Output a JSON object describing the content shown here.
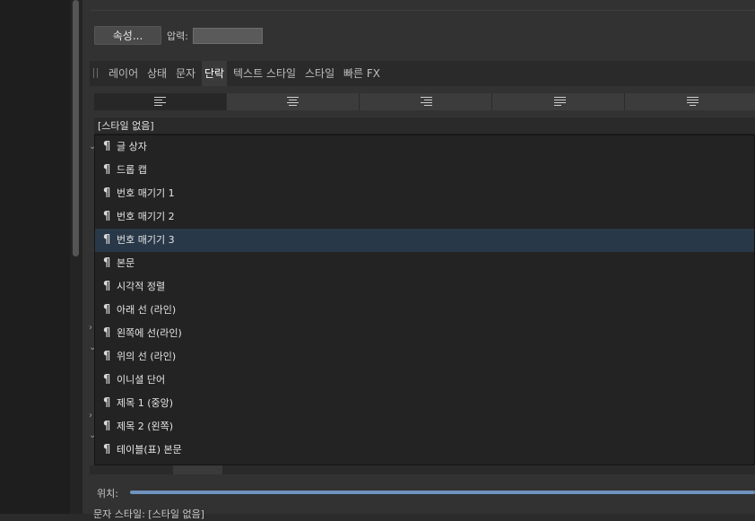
{
  "toolbar": {
    "properties_button": "속성...",
    "pressure_label": "압력:"
  },
  "tabs": [
    {
      "label": "레이어"
    },
    {
      "label": "상태"
    },
    {
      "label": "문자"
    },
    {
      "label": "단락",
      "active": true
    },
    {
      "label": "텍스트 스타일"
    },
    {
      "label": "스타일"
    },
    {
      "label": "빠른 FX"
    }
  ],
  "alignment": {
    "options": [
      "align-left-icon",
      "align-center-icon",
      "align-right-icon",
      "justify-left-icon",
      "justify-center-icon"
    ],
    "selected_index": 0
  },
  "paragraph_style": {
    "selected": "[스타일 없음]",
    "options": [
      "글 상자",
      "드롭 캡",
      "번호 매기기 1",
      "번호 매기기 2",
      "번호 매기기 3",
      "본문",
      "시각적 정렬",
      "아래 선 (라인)",
      "왼쪽에 선(라인)",
      "위의 선 (라인)",
      "이니셜 단어",
      "제목 1 (중앙)",
      "제목 2 (왼쪽)",
      "테이블(표) 본문"
    ],
    "hovered_index": 4,
    "option_glyph": "¶"
  },
  "position": {
    "label": "위치:"
  },
  "character_style": {
    "text": "문자 스타일: [스타일 없음]"
  },
  "colors": {
    "hover_row": "#283848",
    "slider": "#6f93be",
    "panel": "#323232"
  }
}
